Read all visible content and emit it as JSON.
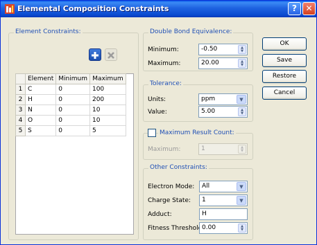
{
  "window": {
    "title": "Elemental Composition Constraints",
    "help_label": "?",
    "close_label": "✕"
  },
  "element_constraints": {
    "title": "Element Constraints:",
    "add_icon": "plus-icon",
    "remove_icon": "x-icon",
    "columns": [
      "",
      "Element",
      "Minimum",
      "Maximum"
    ],
    "rows": [
      {
        "num": "1",
        "element": "C",
        "min": "0",
        "max": "100"
      },
      {
        "num": "2",
        "element": "H",
        "min": "0",
        "max": "200"
      },
      {
        "num": "3",
        "element": "N",
        "min": "0",
        "max": "10"
      },
      {
        "num": "4",
        "element": "O",
        "min": "0",
        "max": "10"
      },
      {
        "num": "5",
        "element": "S",
        "min": "0",
        "max": "5"
      }
    ]
  },
  "dbe": {
    "title": "Double Bond Equivalence:",
    "min_label": "Minimum:",
    "min_value": "-0.50",
    "max_label": "Maximum:",
    "max_value": "20.00"
  },
  "tolerance": {
    "title": "Tolerance:",
    "units_label": "Units:",
    "units_value": "ppm",
    "value_label": "Value:",
    "value_value": "5.00"
  },
  "max_result": {
    "title": "Maximum Result Count:",
    "checked": false,
    "max_label": "Maximum:",
    "max_value": "1"
  },
  "other": {
    "title": "Other Constraints:",
    "electron_label": "Electron Mode:",
    "electron_value": "All",
    "charge_label": "Charge State:",
    "charge_value": "1",
    "adduct_label": "Adduct:",
    "adduct_value": "H",
    "fitness_label": "Fitness Threshold:",
    "fitness_value": "0.00"
  },
  "buttons": {
    "ok": "OK",
    "save": "Save",
    "restore": "Restore",
    "cancel": "Cancel"
  },
  "colors": {
    "title_bar": "#0a4bd1",
    "group_title": "#1f4fb5",
    "dialog_bg": "#ece9d8"
  }
}
